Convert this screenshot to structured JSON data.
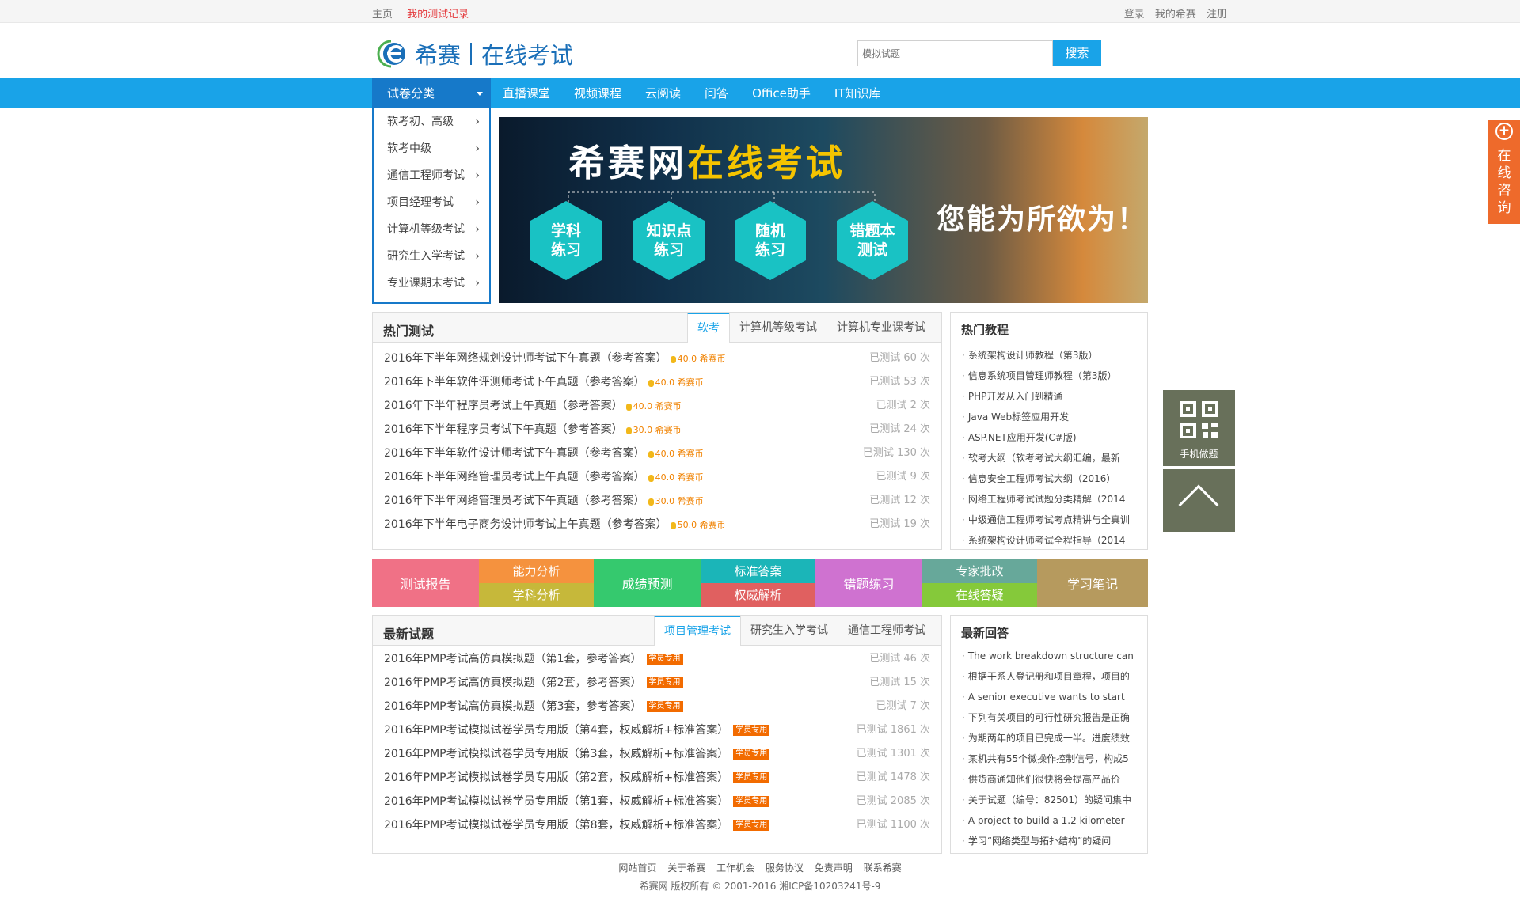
{
  "topbar": {
    "home": "主页",
    "my_tests": "我的测试记录",
    "login": "登录",
    "my_xisai": "我的希赛",
    "register": "注册"
  },
  "header": {
    "logo_text": "希赛",
    "logo_sub": "在线考试",
    "search_placeholder": "模拟试题",
    "search_button": "搜索"
  },
  "nav": {
    "category": "试卷分类",
    "items": [
      "直播课堂",
      "视频课程",
      "云阅读",
      "问答",
      "Office助手",
      "IT知识库"
    ]
  },
  "categories": [
    "软考初、高级",
    "软考中级",
    "通信工程师考试",
    "项目经理考试",
    "计算机等级考试",
    "研究生入学考试",
    "专业课期末考试"
  ],
  "banner": {
    "title_a": "希赛网",
    "title_b": "在线考试",
    "hexes": [
      "学科\n练习",
      "知识点\n练习",
      "随机\n练习",
      "错题本\n测试"
    ],
    "slogan": "您能为所欲为！"
  },
  "hot_tests": {
    "title": "热门测试",
    "tabs": [
      "软考",
      "计算机等级考试",
      "计算机专业课考试"
    ],
    "rows": [
      {
        "name": "2016年下半年网络规划设计师考试下午真题（参考答案）",
        "coin": "40.0 希赛币",
        "count": "已测试 60 次"
      },
      {
        "name": "2016年下半年软件评测师考试下午真题（参考答案）",
        "coin": "40.0 希赛币",
        "count": "已测试 53 次"
      },
      {
        "name": "2016年下半年程序员考试上午真题（参考答案）",
        "coin": "40.0 希赛币",
        "count": "已测试 2 次"
      },
      {
        "name": "2016年下半年程序员考试下午真题（参考答案）",
        "coin": "30.0 希赛币",
        "count": "已测试 24 次"
      },
      {
        "name": "2016年下半年软件设计师考试下午真题（参考答案）",
        "coin": "40.0 希赛币",
        "count": "已测试 130 次"
      },
      {
        "name": "2016年下半年网络管理员考试上午真题（参考答案）",
        "coin": "40.0 希赛币",
        "count": "已测试 9 次"
      },
      {
        "name": "2016年下半年网络管理员考试下午真题（参考答案）",
        "coin": "30.0 希赛币",
        "count": "已测试 12 次"
      },
      {
        "name": "2016年下半年电子商务设计师考试上午真题（参考答案）",
        "coin": "50.0 希赛币",
        "count": "已测试 19 次"
      }
    ]
  },
  "hot_tutorials": {
    "title": "热门教程",
    "items": [
      "系统架构设计师教程（第3版）",
      "信息系统项目管理师教程（第3版）",
      "PHP开发从入门到精通",
      "Java Web标签应用开发",
      "ASP.NET应用开发(C#版)",
      "软考大纲（软考考试大纲汇编，最新",
      "信息安全工程师考试大纲（2016）",
      "网络工程师考试试题分类精解（2014",
      "中级通信工程师考试考点精讲与全真训",
      "系统架构设计师考试全程指导（2014"
    ]
  },
  "features": {
    "report": "测试报告",
    "ability": "能力分析",
    "subject": "学科分析",
    "predict": "成绩预测",
    "standard": "标准答案",
    "authority": "权威解析",
    "wrong": "错题练习",
    "expert": "专家批改",
    "online": "在线答疑",
    "notes": "学习笔记"
  },
  "latest": {
    "title": "最新试题",
    "tabs": [
      "项目管理考试",
      "研究生入学考试",
      "通信工程师考试"
    ],
    "rows": [
      {
        "name": "2016年PMP考试高仿真模拟题（第1套，参考答案）",
        "tag": "学员专用",
        "count": "已测试 46 次"
      },
      {
        "name": "2016年PMP考试高仿真模拟题（第2套，参考答案）",
        "tag": "学员专用",
        "count": "已测试 15 次"
      },
      {
        "name": "2016年PMP考试高仿真模拟题（第3套，参考答案）",
        "tag": "学员专用",
        "count": "已测试 7 次"
      },
      {
        "name": "2016年PMP考试模拟试卷学员专用版（第4套，权威解析+标准答案）",
        "tag": "学员专用",
        "count": "已测试 1861 次"
      },
      {
        "name": "2016年PMP考试模拟试卷学员专用版（第3套，权威解析+标准答案）",
        "tag": "学员专用",
        "count": "已测试 1301 次"
      },
      {
        "name": "2016年PMP考试模拟试卷学员专用版（第2套，权威解析+标准答案）",
        "tag": "学员专用",
        "count": "已测试 1478 次"
      },
      {
        "name": "2016年PMP考试模拟试卷学员专用版（第1套，权威解析+标准答案）",
        "tag": "学员专用",
        "count": "已测试 2085 次"
      },
      {
        "name": "2016年PMP考试模拟试卷学员专用版（第8套，权威解析+标准答案）",
        "tag": "学员专用",
        "count": "已测试 1100 次"
      }
    ]
  },
  "latest_answers": {
    "title": "最新回答",
    "items": [
      "The work breakdown structure can",
      "根据干系人登记册和项目章程，项目的",
      "A senior executive wants to start",
      "下列有关项目的可行性研究报告是正确",
      "为期两年的项目已完成一半。进度绩效",
      "某机共有55个微操作控制信号，构成5",
      "供货商通知他们很快将会提高产品价",
      "关于试题（编号：82501）的疑问集中",
      "A project to build a 1.2 kilometer",
      "学习“网络类型与拓扑结构”的疑问"
    ]
  },
  "footer": {
    "links": [
      "网站首页",
      "关于希赛",
      "工作机会",
      "服务协议",
      "免责声明",
      "联系希赛"
    ],
    "copyright": "希赛网 版权所有 © 2001-2016  湘ICP备10203241号-9"
  },
  "float": {
    "consult": "在线咨询",
    "qr_label": "手机做题"
  },
  "colors": {
    "brand_blue": "#19a3e8",
    "dark_blue": "#1679c9",
    "coin": "#f08200"
  }
}
